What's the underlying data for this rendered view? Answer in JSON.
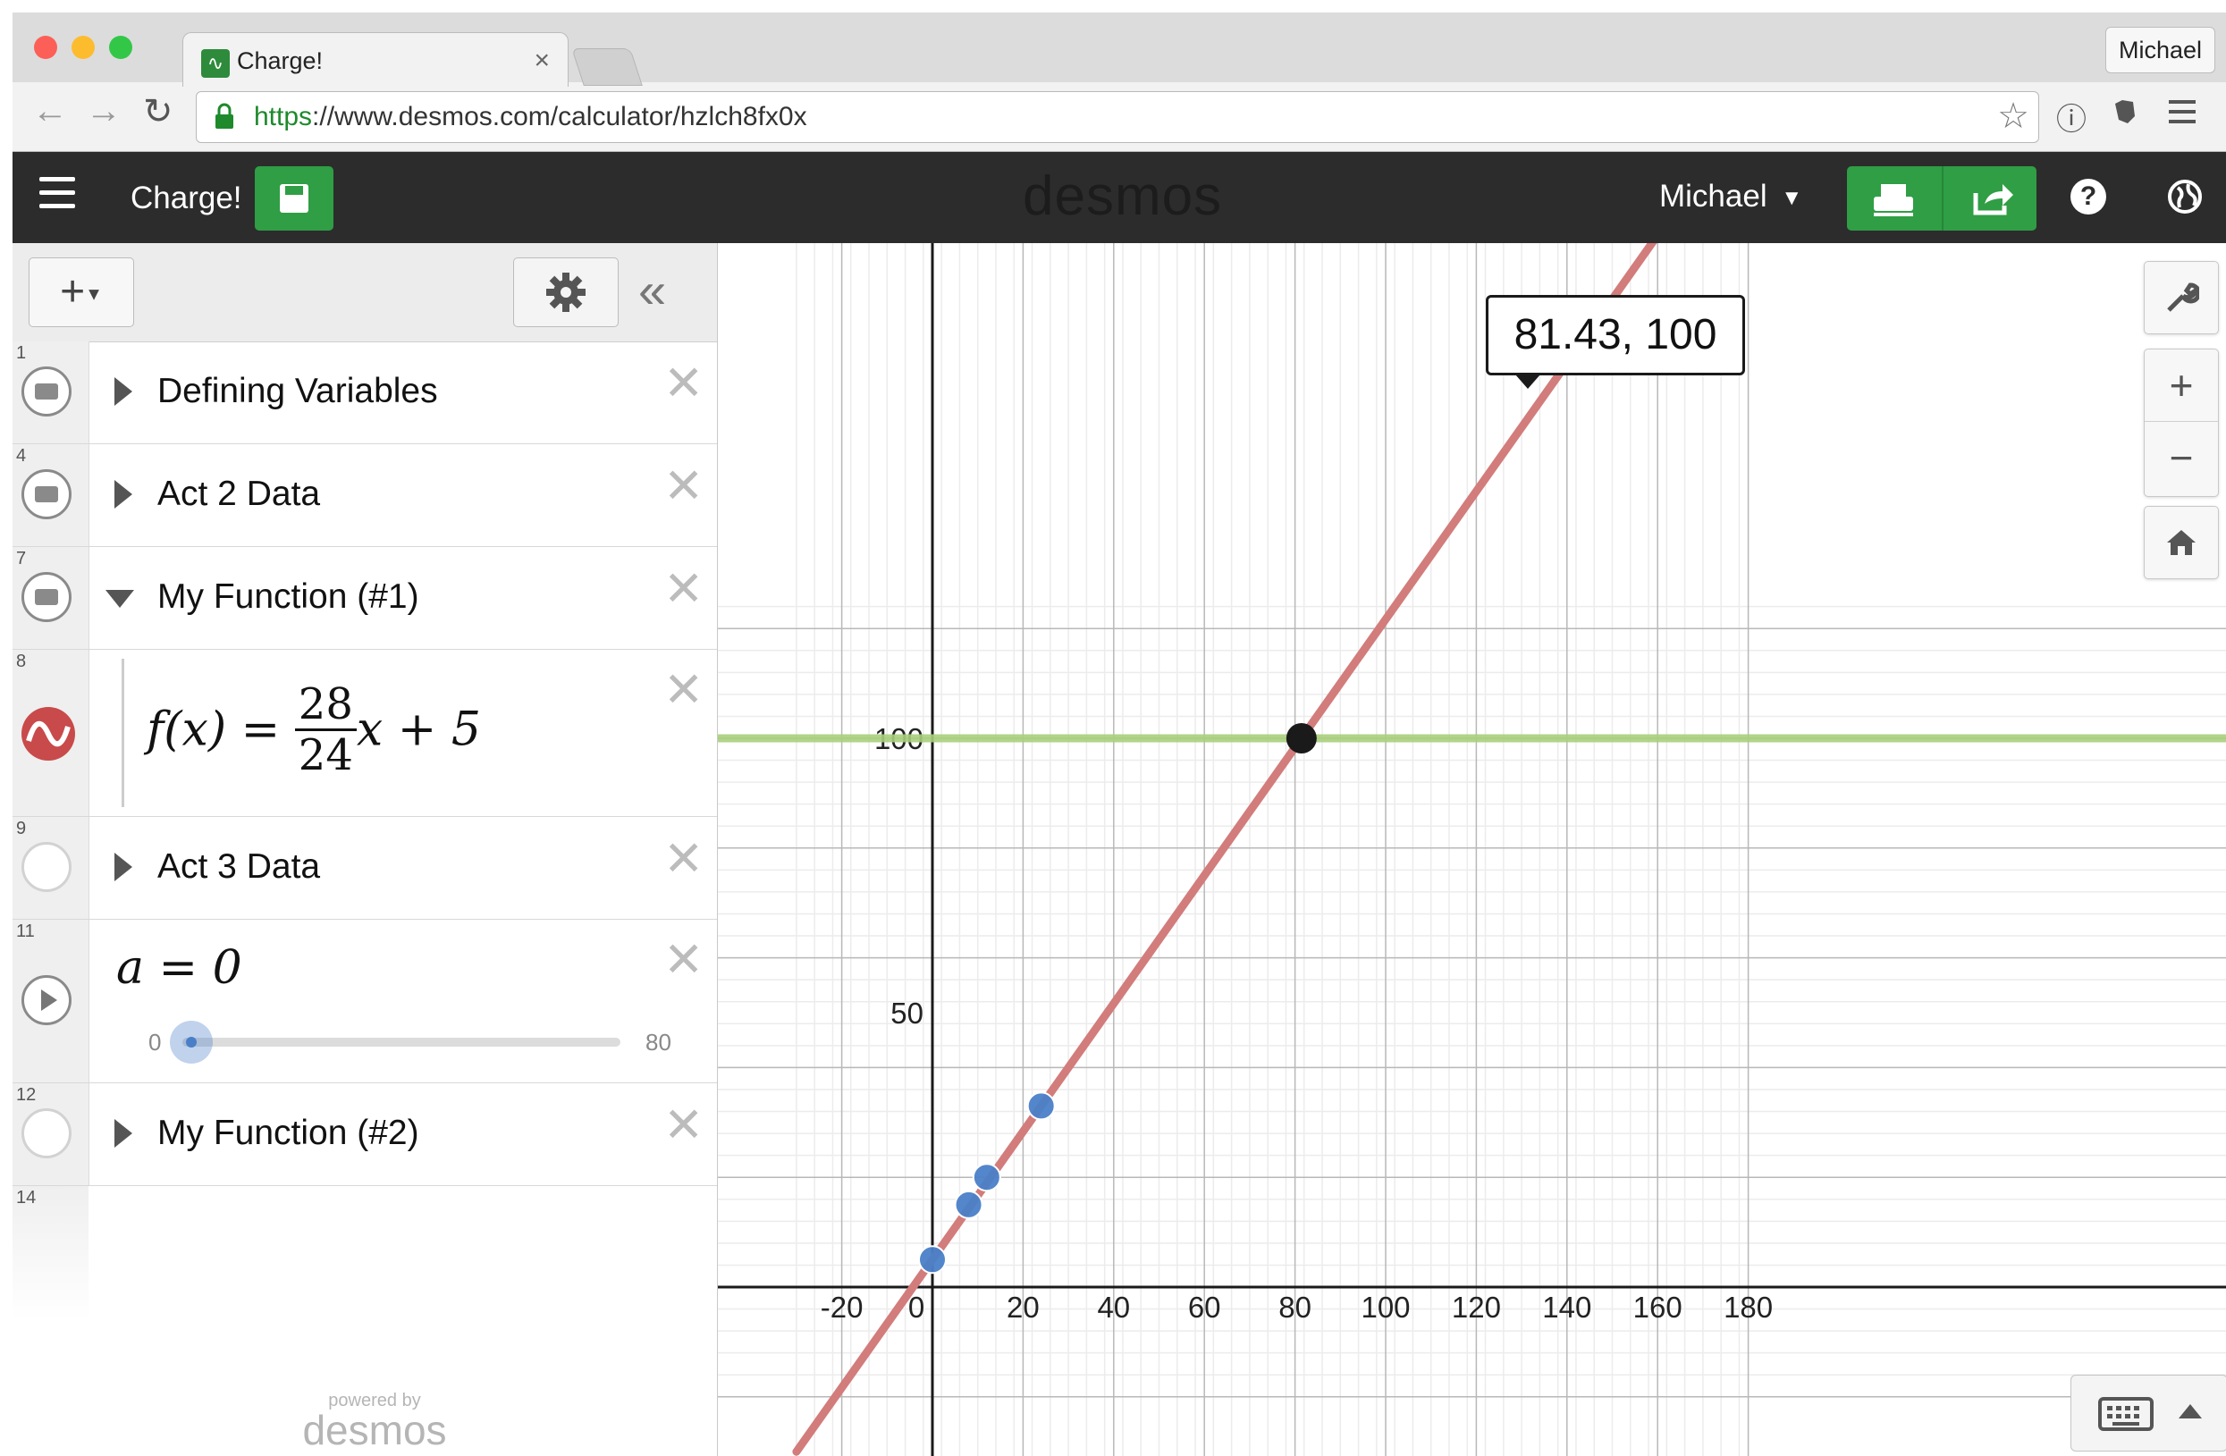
{
  "browser": {
    "tab_title": "Charge!",
    "tab_close": "×",
    "profile_name": "Michael",
    "url_scheme": "https",
    "url_rest": "://www.desmos.com/calculator/hzlch8fx0x"
  },
  "header": {
    "title": "Charge!",
    "logo": "desmos",
    "user": "Michael",
    "help": "?"
  },
  "expressions": {
    "add_label": "+",
    "collapse_label": "«",
    "rows": [
      {
        "number": "1",
        "title": "Defining Variables"
      },
      {
        "number": "4",
        "title": "Act 2 Data"
      },
      {
        "number": "7",
        "title": "My Function (#1)"
      },
      {
        "number": "8",
        "lhs": "f(x) = ",
        "numerator": "28",
        "denominator": "24",
        "rhs": "x + 5"
      },
      {
        "number": "9",
        "title": "Act 3 Data"
      },
      {
        "number": "11",
        "expr": "a = 0",
        "slider_min": "0",
        "slider_max": "80",
        "slider_value": 0
      },
      {
        "number": "12",
        "title": "My Function (#2)"
      },
      {
        "number": "14"
      }
    ],
    "powered_by": "powered by",
    "footer_logo": "desmos"
  },
  "graph": {
    "tooltip": "81.43, 100"
  },
  "colors": {
    "function_line": "#d27c7c",
    "horizontal_line": "#a8cf7c",
    "points": "#4a7fc8",
    "accent_green": "#2f9e44"
  },
  "chart_data": {
    "type": "scatter",
    "title": "",
    "xlabel": "",
    "ylabel": "",
    "xlim": [
      -30,
      180
    ],
    "ylim": [
      -20,
      122
    ],
    "x_ticks": [
      -20,
      0,
      20,
      40,
      60,
      80,
      100,
      120,
      140,
      160,
      180
    ],
    "y_ticks": [
      50,
      100
    ],
    "grid": true,
    "lines": [
      {
        "kind": "function",
        "expression": "f(x) = 28/24 x + 5",
        "slope": 1.1667,
        "intercept": 5
      },
      {
        "kind": "horizontal",
        "expression": "y = 100",
        "y": 100
      }
    ],
    "series": [
      {
        "values": [
          [
            0,
            5
          ],
          [
            8,
            15
          ],
          [
            12,
            20
          ],
          [
            24,
            33
          ]
        ]
      }
    ],
    "highlight_point": {
      "x": 81.43,
      "y": 100
    }
  }
}
